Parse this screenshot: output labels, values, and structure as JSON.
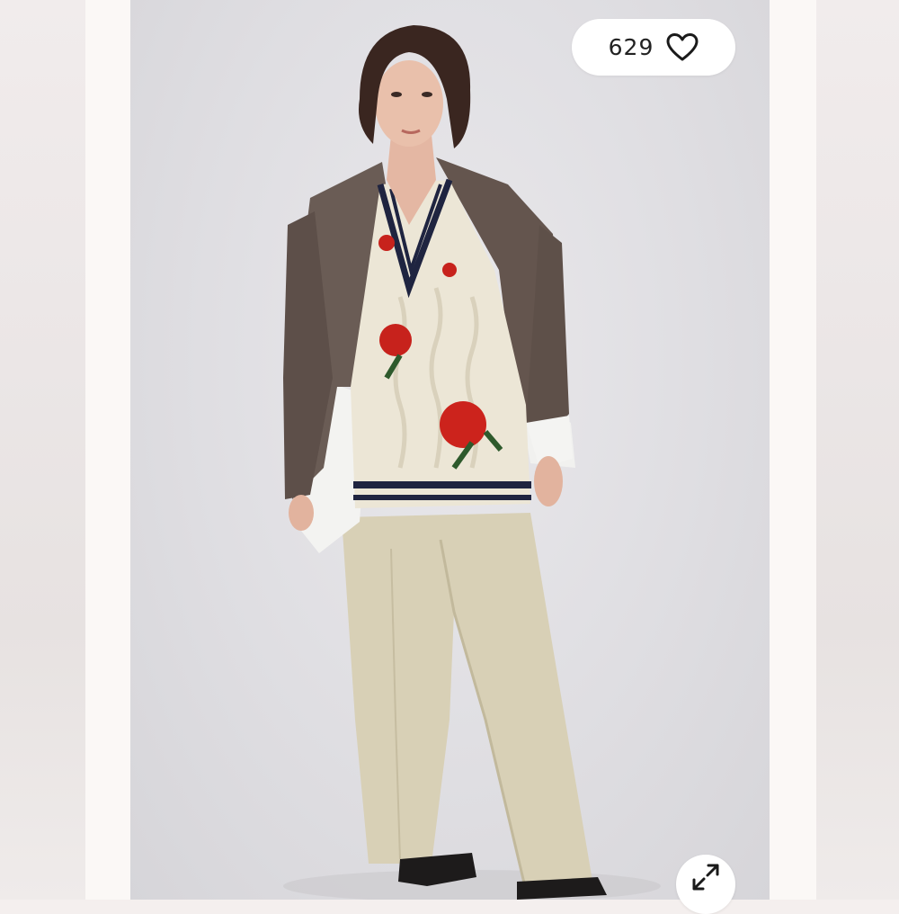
{
  "product_image": {
    "alt": "",
    "likes": {
      "count": "629",
      "icon": "heart-icon"
    },
    "expand": {
      "icon": "expand-arrows-icon"
    }
  },
  "colors": {
    "background": "#f4efee",
    "photo_backdrop": "#dfdee2",
    "pill": "#ffffff"
  }
}
